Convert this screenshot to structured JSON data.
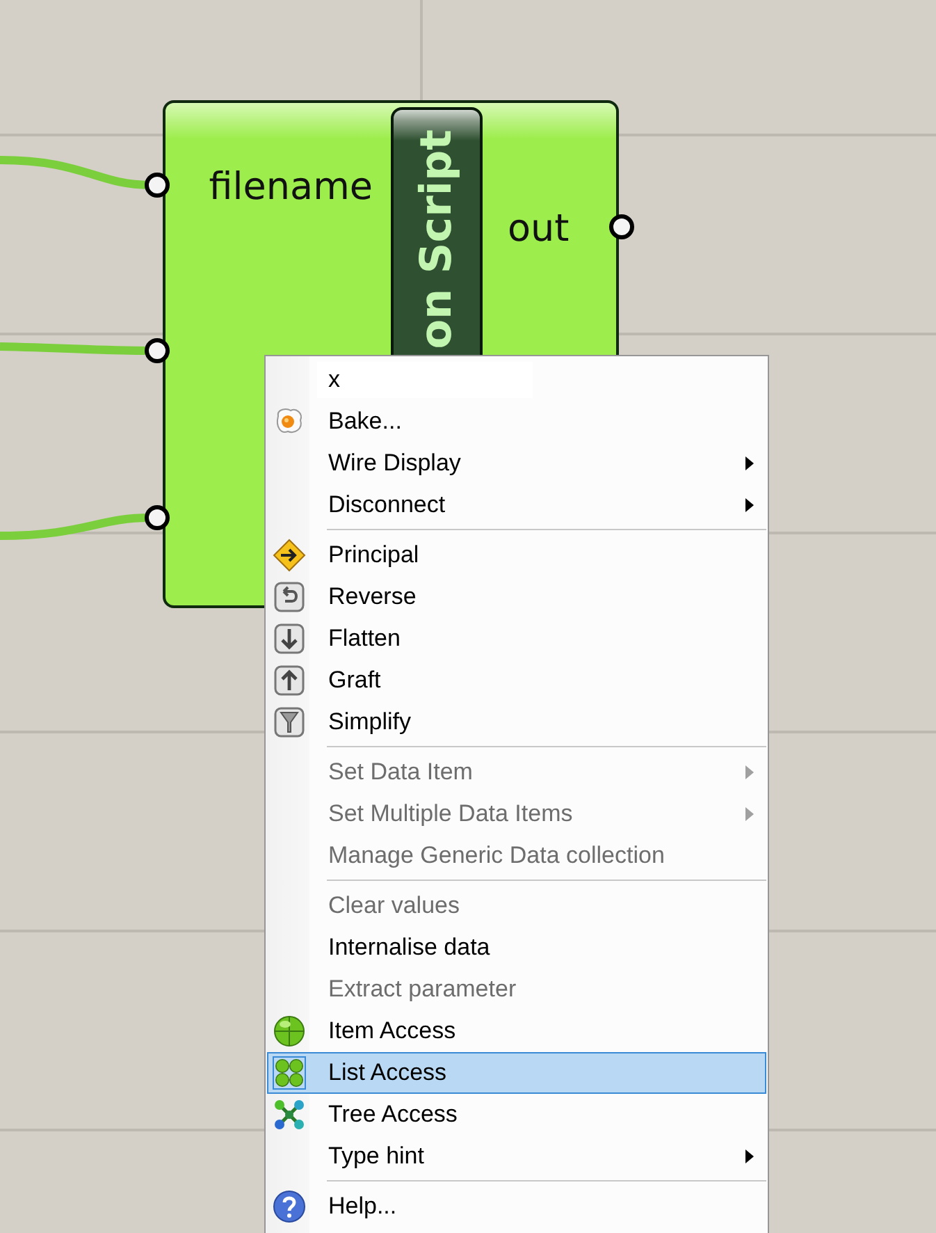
{
  "component": {
    "title": "on Script",
    "inputs": [
      {
        "label": "filename",
        "wired": true
      },
      {
        "wired": true
      },
      {
        "wired": true
      }
    ],
    "outputs": [
      {
        "label": "out",
        "wired": false
      }
    ]
  },
  "menu": {
    "name_field": {
      "value": "x"
    },
    "items": [
      {
        "kind": "bake",
        "label": "Bake...",
        "disabled": false,
        "submenu": false,
        "selected": false
      },
      {
        "kind": "item",
        "label": "Wire Display",
        "disabled": false,
        "submenu": true,
        "selected": false
      },
      {
        "kind": "item",
        "label": "Disconnect",
        "disabled": false,
        "submenu": true,
        "selected": false
      },
      {
        "kind": "separator"
      },
      {
        "kind": "principal",
        "label": "Principal",
        "disabled": false,
        "submenu": false,
        "selected": false
      },
      {
        "kind": "reverse",
        "label": "Reverse",
        "disabled": false,
        "submenu": false,
        "selected": false
      },
      {
        "kind": "flatten",
        "label": "Flatten",
        "disabled": false,
        "submenu": false,
        "selected": false
      },
      {
        "kind": "graft",
        "label": "Graft",
        "disabled": false,
        "submenu": false,
        "selected": false
      },
      {
        "kind": "simplify",
        "label": "Simplify",
        "disabled": false,
        "submenu": false,
        "selected": false
      },
      {
        "kind": "separator"
      },
      {
        "kind": "item",
        "label": "Set Data Item",
        "disabled": true,
        "submenu": true,
        "selected": false
      },
      {
        "kind": "item",
        "label": "Set Multiple Data Items",
        "disabled": true,
        "submenu": true,
        "selected": false
      },
      {
        "kind": "item",
        "label": "Manage Generic Data collection",
        "disabled": true,
        "submenu": false,
        "selected": false
      },
      {
        "kind": "separator"
      },
      {
        "kind": "item",
        "label": "Clear values",
        "disabled": true,
        "submenu": false,
        "selected": false
      },
      {
        "kind": "item",
        "label": "Internalise data",
        "disabled": false,
        "submenu": false,
        "selected": false
      },
      {
        "kind": "item",
        "label": "Extract parameter",
        "disabled": true,
        "submenu": false,
        "selected": false
      },
      {
        "kind": "single",
        "label": "Item Access",
        "disabled": false,
        "submenu": false,
        "selected": false
      },
      {
        "kind": "list",
        "label": "List Access",
        "disabled": false,
        "submenu": false,
        "selected": true
      },
      {
        "kind": "tree",
        "label": "Tree Access",
        "disabled": false,
        "submenu": false,
        "selected": false
      },
      {
        "kind": "item",
        "label": "Type hint",
        "disabled": false,
        "submenu": true,
        "selected": false
      },
      {
        "kind": "separator"
      },
      {
        "kind": "help",
        "label": "Help...",
        "disabled": false,
        "submenu": false,
        "selected": false
      }
    ]
  }
}
